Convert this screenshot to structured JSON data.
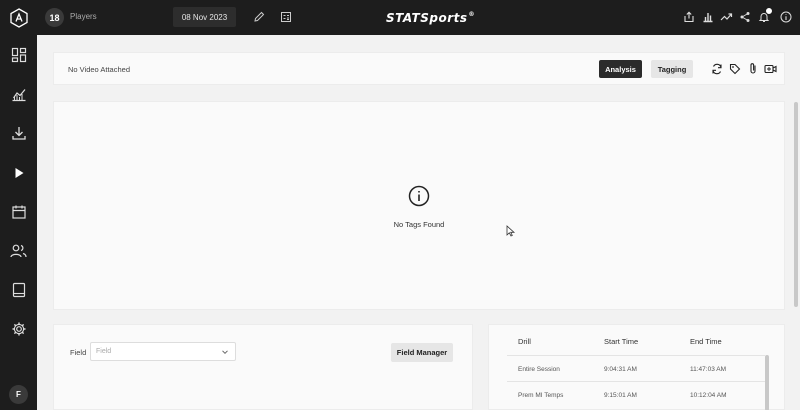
{
  "topbar": {
    "players_count": "18",
    "players_label": "Players",
    "date": "08 Nov 2023",
    "logo_text": "STATSports",
    "logo_mark": "®",
    "icons": [
      "edit-icon",
      "calculator-icon",
      "export-icon",
      "bar-chart-icon",
      "trend-icon",
      "share-icon",
      "bell-icon",
      "info-icon"
    ]
  },
  "sidebar": {
    "icons": [
      "dashboard-icon",
      "analytics-icon",
      "download-icon",
      "play-icon",
      "calendar-icon",
      "users-icon",
      "tablet-icon",
      "settings-icon"
    ],
    "avatar_initial": "F"
  },
  "video_bar": {
    "status": "No Video Attached",
    "analysis_label": "Analysis",
    "tagging_label": "Tagging",
    "icons": [
      "refresh-icon",
      "tag-icon",
      "paperclip-icon",
      "video-camera-icon"
    ]
  },
  "tags_panel": {
    "empty_message": "No Tags Found"
  },
  "field_panel": {
    "label": "Field",
    "placeholder": "Field",
    "manager_button": "Field Manager"
  },
  "drill_table": {
    "columns": [
      "Drill",
      "Start Time",
      "End Time"
    ],
    "rows": [
      {
        "drill": "Entire Session",
        "start": "9:04:31 AM",
        "end": "11:47:03 AM"
      },
      {
        "drill": "Prem MI Temps",
        "start": "9:15:01 AM",
        "end": "10:12:04 AM"
      }
    ]
  },
  "colors": {
    "chrome": "#1d1d1d",
    "accent_dark": "#2b2b2b",
    "background": "#f2f2f2"
  }
}
